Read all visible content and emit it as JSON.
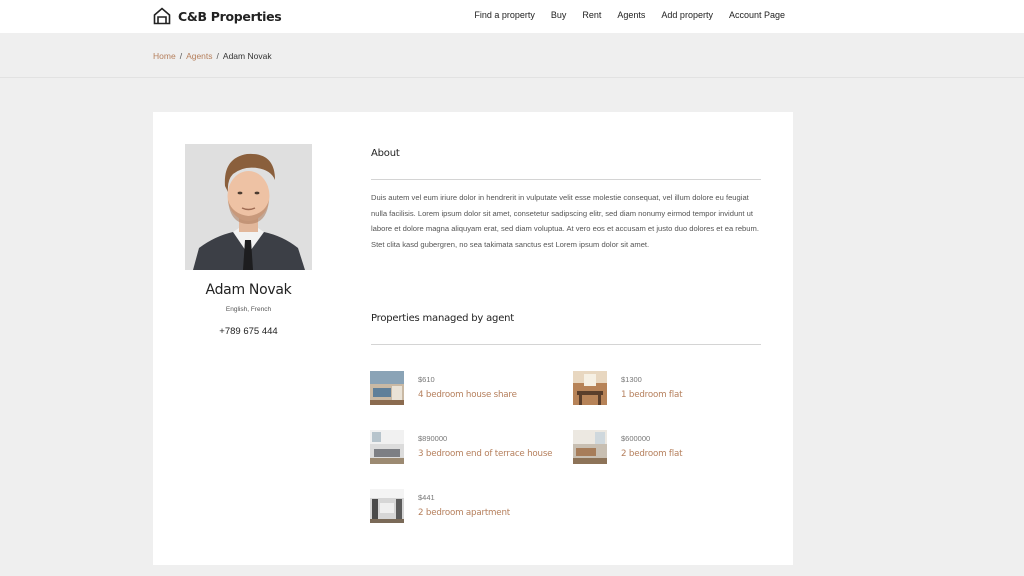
{
  "header": {
    "brand": "C&B Properties",
    "nav": [
      "Find a property",
      "Buy",
      "Rent",
      "Agents",
      "Add property",
      "Account Page"
    ]
  },
  "breadcrumb": {
    "home": "Home",
    "agents": "Agents",
    "current": "Adam Novak",
    "separator": "/"
  },
  "agent": {
    "name": "Adam Novak",
    "languages": "English, French",
    "phone": "+789 675 444"
  },
  "about": {
    "title": "About",
    "text": "Duis autem vel eum iriure dolor in hendrerit in vulputate velit esse molestie consequat, vel illum dolore eu feugiat nulla facilisis. Lorem ipsum dolor sit amet, consetetur sadipscing elitr, sed diam nonumy eirmod tempor invidunt ut labore et dolore magna aliquyam erat, sed diam voluptua. At vero eos et accusam et justo duo dolores et ea rebum. Stet clita kasd gubergren, no sea takimata sanctus est Lorem ipsum dolor sit amet."
  },
  "properties": {
    "title": "Properties managed by agent",
    "items": [
      {
        "price": "$610",
        "title": "4 bedroom house share"
      },
      {
        "price": "$1300",
        "title": "1 bedroom flat"
      },
      {
        "price": "$890000",
        "title": "3 bedroom end of terrace house"
      },
      {
        "price": "$600000",
        "title": "2 bedroom flat"
      },
      {
        "price": "$441",
        "title": "2 bedroom apartment"
      }
    ]
  },
  "colors": {
    "accent": "#b57f5c",
    "background": "#efefef",
    "card": "#ffffff"
  }
}
